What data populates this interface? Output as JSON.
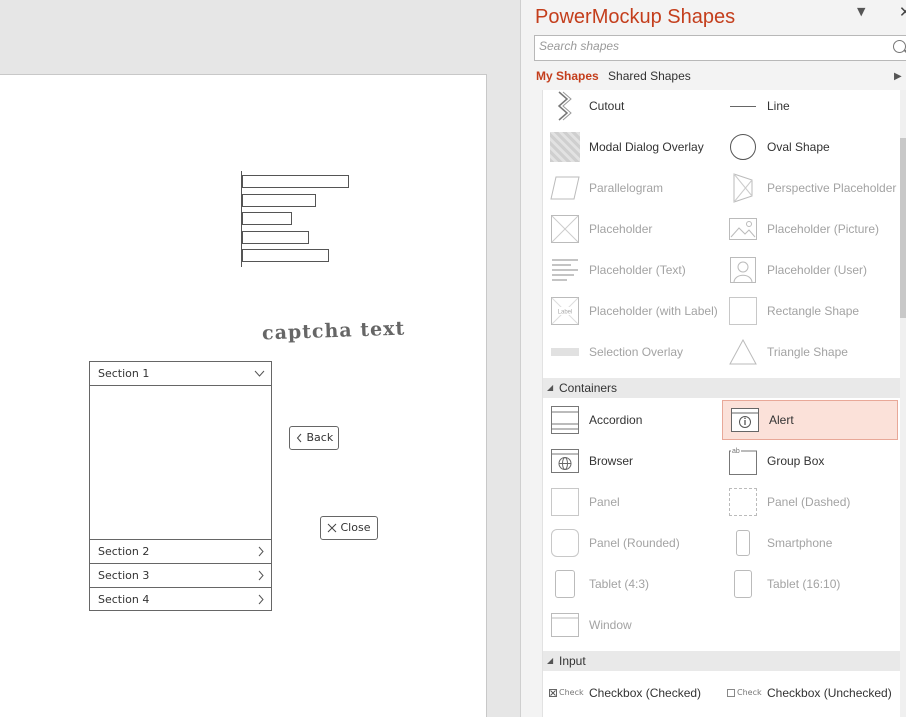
{
  "canvas": {
    "captcha_text": "captcha text",
    "accordion": {
      "sections": [
        "Section 1",
        "Section 2",
        "Section 3",
        "Section 4"
      ]
    },
    "back_button": "Back",
    "close_button": "Close"
  },
  "panel": {
    "title": "PowerMockup Shapes",
    "search_placeholder": "Search shapes",
    "tabs": {
      "my_shapes": "My Shapes",
      "shared_shapes": "Shared Shapes"
    },
    "basic_shapes": [
      {
        "left": "Cutout",
        "right": "Line"
      },
      {
        "left": "Modal Dialog Overlay",
        "right": "Oval Shape"
      },
      {
        "left": "Parallelogram",
        "right": "Perspective Placeholder"
      },
      {
        "left": "Placeholder",
        "right": "Placeholder (Picture)"
      },
      {
        "left": "Placeholder (Text)",
        "right": "Placeholder (User)"
      },
      {
        "left": "Placeholder (with Label)",
        "right": "Rectangle Shape"
      },
      {
        "left": "Selection Overlay",
        "right": "Triangle Shape"
      }
    ],
    "containers": {
      "header": "Containers",
      "items": [
        {
          "left": "Accordion",
          "right": "Alert"
        },
        {
          "left": "Browser",
          "right": "Group Box"
        },
        {
          "left": "Panel",
          "right": "Panel (Dashed)"
        },
        {
          "left": "Panel (Rounded)",
          "right": "Smartphone"
        },
        {
          "left": "Tablet (4:3)",
          "right": "Tablet (16:10)"
        },
        {
          "left": "Window",
          "right": ""
        }
      ]
    },
    "input": {
      "header": "Input",
      "items": [
        {
          "left": "Checkbox (Checked)",
          "right": "Checkbox (Unchecked)"
        }
      ],
      "thumb_label": "Check"
    },
    "icons": {
      "dropdown": "▼",
      "close": "✕",
      "tabs_arrow": "▶",
      "collapse": "◢"
    },
    "accent_color": "#c43e1c",
    "selected_color": "#fbe1d9"
  }
}
